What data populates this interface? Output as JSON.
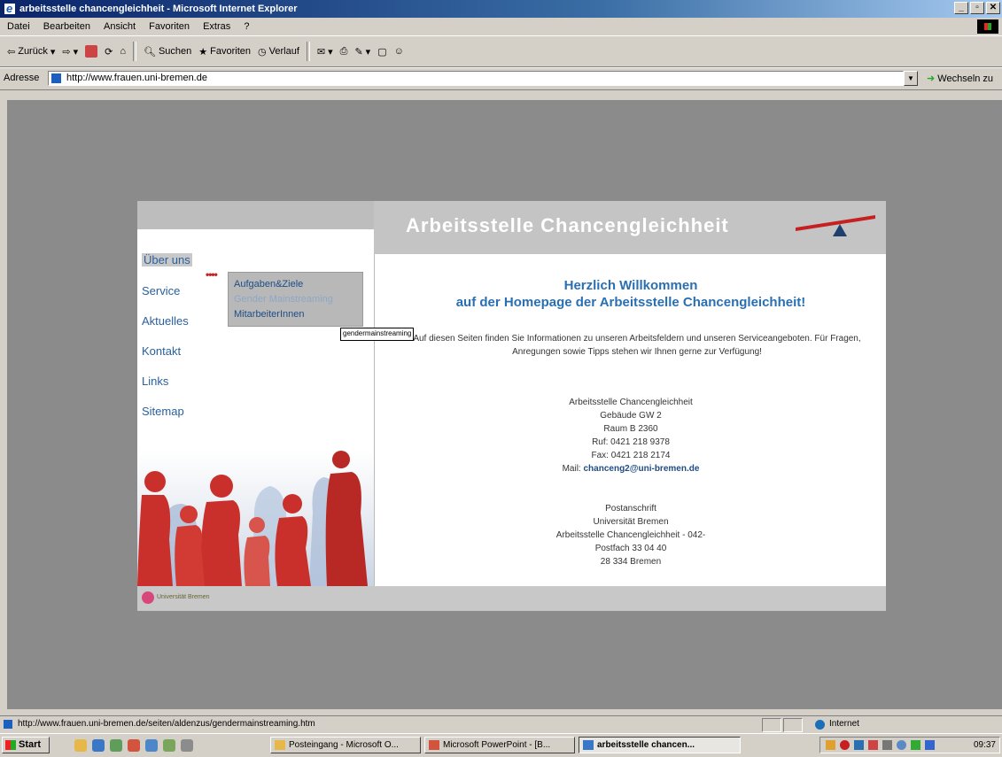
{
  "window": {
    "title": "arbeitsstelle chancengleichheit - Microsoft Internet Explorer",
    "controls": [
      "_",
      "▫",
      "✕"
    ]
  },
  "menu": [
    "Datei",
    "Bearbeiten",
    "Ansicht",
    "Favoriten",
    "Extras",
    "?"
  ],
  "toolbar": {
    "back": "Zurück",
    "search": "Suchen",
    "favorites": "Favoriten",
    "history": "Verlauf"
  },
  "address": {
    "label": "Adresse",
    "url": "http://www.frauen.uni-bremen.de",
    "go": "Wechseln zu"
  },
  "site": {
    "header_title": "Arbeitsstelle Chancengleichheit",
    "nav": [
      "Über uns",
      "Service",
      "Aktuelles",
      "Kontakt",
      "Links",
      "Sitemap"
    ],
    "submenu": [
      "Aufgaben&Ziele",
      "Gender Mainstreaming",
      "MitarbeiterInnen"
    ],
    "tooltip": "gendermainstreaming",
    "welcome_line1": "Herzlich Willkommen",
    "welcome_line2": "auf der Homepage der Arbeitsstelle Chancengleichheit!",
    "intro": "Auf diesen Seiten finden Sie Informationen zu unseren Arbeitsfeldern und unseren Serviceangeboten. Für Fragen, Anregungen sowie Tipps stehen wir Ihnen gerne zur Verfügung!",
    "contact": {
      "name": "Arbeitsstelle Chancengleichheit",
      "building": "Gebäude GW 2",
      "room": "Raum B 2360",
      "phone": "Ruf: 0421 218 9378",
      "fax": "Fax: 0421 218 2174",
      "mail_label": "Mail:",
      "mail": "chanceng2@uni-bremen.de"
    },
    "postal": {
      "heading": "Postanschrift",
      "line1": "Universität Bremen",
      "line2": "Arbeitsstelle Chancengleichheit - 042-",
      "line3": "Postfach 33 04 40",
      "line4": "28 334 Bremen"
    },
    "footer_logo": "Universität Bremen",
    "colors": {
      "accent_red": "#c62020",
      "link_blue": "#29609e",
      "header_gray": "#c4c4c4"
    }
  },
  "status": {
    "url": "http://www.frauen.uni-bremen.de/seiten/aldenzus/gendermainstreaming.htm",
    "zone": "Internet"
  },
  "taskbar": {
    "start": "Start",
    "tasks": [
      "Posteingang - Microsoft O...",
      "Microsoft PowerPoint - [B...",
      "arbeitsstelle chancen..."
    ],
    "clock": "09:37"
  }
}
